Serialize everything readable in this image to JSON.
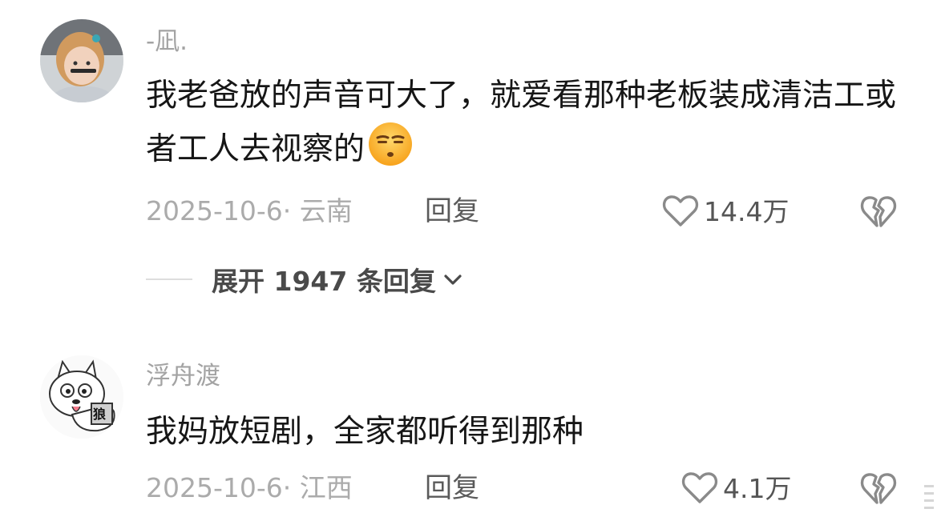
{
  "comments": [
    {
      "username": "-凪.",
      "text": "我老爸放的声音可大了，就爱看那种老板装成清洁工或者工人去视察的",
      "emoji": "unamused-face-emoji",
      "date_location": "2025-10-6· 云南",
      "reply_label": "回复",
      "like_count": "14.4万",
      "avatar": "avatar-photo-girl"
    },
    {
      "username": "浮舟渡",
      "text": "我妈放短剧，全家都听得到那种",
      "date_location": "2025-10-6· 江西",
      "reply_label": "回复",
      "like_count": "4.1万",
      "avatar": "avatar-cartoon-wolf",
      "avatar_badge": "狼"
    }
  ],
  "expand_replies": {
    "label": "展开 1947 条回复"
  },
  "icons": {
    "like": "heart-outline-icon",
    "dislike": "broken-heart-icon",
    "expand": "chevron-down-icon"
  },
  "colors": {
    "muted_text": "#ababab",
    "body_text": "#161616"
  }
}
